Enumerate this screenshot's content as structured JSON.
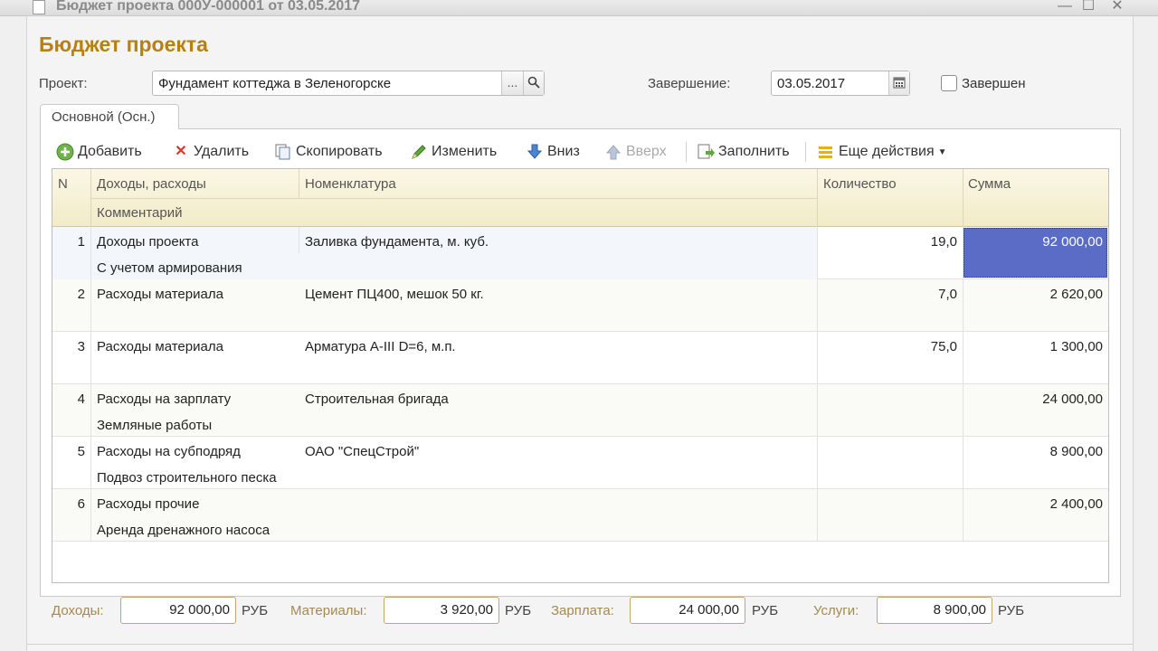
{
  "window": {
    "title": "Бюджет проекта 000У-000001 от 03.05.2017",
    "controls": {
      "minimize": "—",
      "maximize": "☐",
      "close": "✕"
    }
  },
  "form": {
    "title": "Бюджет проекта",
    "project_label": "Проект:",
    "project_value": "Фундамент коттеджа в Зеленогорске",
    "select_button": "...",
    "completion_label": "Завершение:",
    "completion_value": "03.05.2017",
    "completed_label": "Завершен",
    "completed_checked": false
  },
  "tab": {
    "label": "Основной (Осн.)"
  },
  "toolbar": {
    "add": "Добавить",
    "delete": "Удалить",
    "copy": "Скопировать",
    "edit": "Изменить",
    "down": "Вниз",
    "up": "Вверх",
    "fill": "Заполнить",
    "more": "Еще действия"
  },
  "table": {
    "headers": {
      "n": "N",
      "type": "Доходы, расходы",
      "comment": "Комментарий",
      "item": "Номенклатура",
      "qty": "Количество",
      "sum": "Сумма"
    },
    "rows": [
      {
        "n": "1",
        "type": "Доходы проекта",
        "item": "Заливка фундамента, м. куб.",
        "qty": "19,0",
        "sum": "92 000,00",
        "comment": "С учетом армирования"
      },
      {
        "n": "2",
        "type": "Расходы материала",
        "item": "Цемент ПЦ400, мешок 50 кг.",
        "qty": "7,0",
        "sum": "2 620,00",
        "comment": ""
      },
      {
        "n": "3",
        "type": "Расходы материала",
        "item": "Арматура A-III D=6, м.п.",
        "qty": "75,0",
        "sum": "1 300,00",
        "comment": ""
      },
      {
        "n": "4",
        "type": "Расходы на зарплату",
        "item": "Строительная бригада",
        "qty": "",
        "sum": "24 000,00",
        "comment": "Земляные работы"
      },
      {
        "n": "5",
        "type": "Расходы на субподряд",
        "item": "ОАО \"СпецСтрой\"",
        "qty": "",
        "sum": "8 900,00",
        "comment": "Подвоз строительного песка"
      },
      {
        "n": "6",
        "type": "Расходы прочие",
        "item": "",
        "qty": "",
        "sum": "2 400,00",
        "comment": "Аренда дренажного насоса"
      }
    ]
  },
  "totals": {
    "income_label": "Доходы:",
    "income_value": "92 000,00",
    "materials_label": "Материалы:",
    "materials_value": "3 920,00",
    "salary_label": "Зарплата:",
    "salary_value": "24 000,00",
    "services_label": "Услуги:",
    "services_value": "8 900,00",
    "currency": "РУБ"
  },
  "colors": {
    "accent": "#b8810f",
    "selection": "#5a6cc6",
    "header_bg": "#f2ebc9"
  }
}
